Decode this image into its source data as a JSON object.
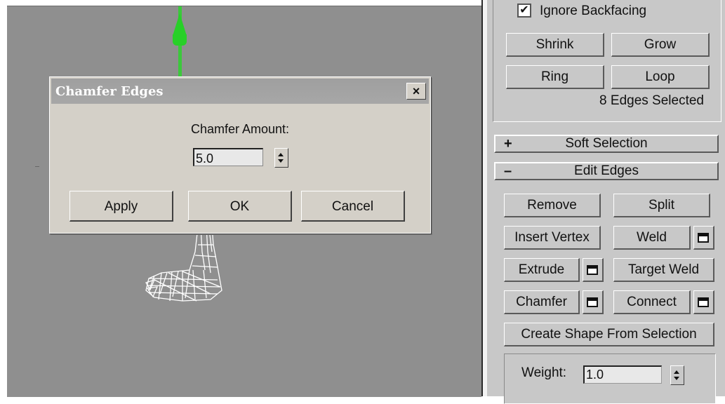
{
  "dialog": {
    "title": "Chamfer Edges",
    "close_label": "×",
    "amount_label": "Chamfer Amount:",
    "amount_value": "5.0",
    "apply_label": "Apply",
    "ok_label": "OK",
    "cancel_label": "Cancel"
  },
  "selection": {
    "ignore_backfacing_label": "Ignore Backfacing",
    "ignore_backfacing_checked": true,
    "shrink_label": "Shrink",
    "grow_label": "Grow",
    "ring_label": "Ring",
    "loop_label": "Loop",
    "edges_selected": "8 Edges Selected"
  },
  "soft_selection": {
    "sign": "+",
    "label": "Soft Selection"
  },
  "edit_edges": {
    "sign": "–",
    "label": "Edit Edges",
    "remove_label": "Remove",
    "split_label": "Split",
    "insert_vertex_label": "Insert Vertex",
    "weld_label": "Weld",
    "extrude_label": "Extrude",
    "target_weld_label": "Target Weld",
    "chamfer_label": "Chamfer",
    "connect_label": "Connect",
    "create_shape_label": "Create Shape From Selection",
    "weight_label": "Weight:",
    "weight_value": "1.0"
  },
  "colors": {
    "viewport_bg": "#8f8f8f",
    "gizmo_y_axis": "#28d028",
    "panel_bg": "#c8c8c8",
    "dialog_bg": "#d4d0c8"
  }
}
